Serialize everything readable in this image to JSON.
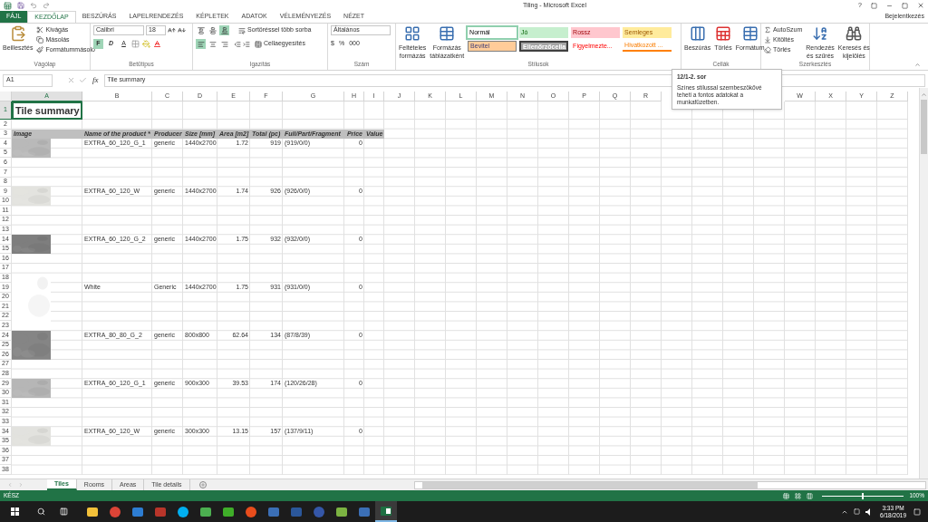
{
  "title_bar": {
    "title": "Tiling - Microsoft Excel",
    "help": "?",
    "account": "Bejelentkezés"
  },
  "tabs": [
    {
      "label": "FÁJL",
      "kind": "file",
      "selected": false
    },
    {
      "label": "KEZDŐLAP",
      "kind": "tab",
      "selected": true
    },
    {
      "label": "BESZÚRÁS",
      "kind": "tab",
      "selected": false
    },
    {
      "label": "LAPELRENDEZÉS",
      "kind": "tab",
      "selected": false
    },
    {
      "label": "KÉPLETEK",
      "kind": "tab",
      "selected": false
    },
    {
      "label": "ADATOK",
      "kind": "tab",
      "selected": false
    },
    {
      "label": "VÉLEMÉNYEZÉS",
      "kind": "tab",
      "selected": false
    },
    {
      "label": "NÉZET",
      "kind": "tab",
      "selected": false
    }
  ],
  "ribbon": {
    "clipboard": {
      "paste": "Beillesztés",
      "cut": "Kivágás",
      "copy": "Másolás",
      "format_painter": "Formátummásoló",
      "label": "Vágólap"
    },
    "font": {
      "name": "Calibri",
      "size": "18",
      "styles": [
        {
          "label": "F",
          "kind": "bold",
          "selected": true
        },
        {
          "label": "D",
          "kind": "italic",
          "selected": false
        },
        {
          "label": "A",
          "kind": "underline",
          "selected": false
        }
      ],
      "label": "Betűtípus"
    },
    "alignment": {
      "vertical": [
        {
          "kind": "top",
          "selected": false
        },
        {
          "kind": "middle",
          "selected": false
        },
        {
          "kind": "bottom",
          "selected": true
        }
      ],
      "horizontal": [
        {
          "kind": "left",
          "selected": true
        },
        {
          "kind": "center",
          "selected": false
        },
        {
          "kind": "right",
          "selected": false
        }
      ],
      "wrap": "Sortöréssel több sorba",
      "merge": "Cellaegyesítés",
      "label": "Igazítás"
    },
    "number": {
      "format": "Általános",
      "currency": "$",
      "percent": "%",
      "thousands": "000",
      "label": "Szám"
    },
    "styles": {
      "conditional": [
        "Feltételes",
        "formázás"
      ],
      "as_table": [
        "Formázás",
        "táblázatként"
      ],
      "cells": [
        {
          "label": "Normál",
          "kind": "normal",
          "selected": true
        },
        {
          "label": "Jó",
          "kind": "good",
          "selected": false
        },
        {
          "label": "Rossz",
          "kind": "bad",
          "selected": false
        },
        {
          "label": "Semleges",
          "kind": "neutral",
          "selected": false
        },
        {
          "label": "Bevitel",
          "kind": "input",
          "selected": false
        },
        {
          "label": "Ellenőrzőcella",
          "kind": "check",
          "selected": false
        },
        {
          "label": "Figyelmezte...",
          "kind": "warning",
          "selected": false
        },
        {
          "label": "Hivatkozott ...",
          "kind": "linked",
          "selected": false
        }
      ],
      "label": "Stílusok"
    },
    "cells": {
      "insert": "Beszúrás",
      "delete": "Törlés",
      "format": "Formátum",
      "label": "Cellák"
    },
    "editing": {
      "autosum": "AutoSzum",
      "fill": "Kitöltés",
      "clear": "Törlés",
      "sort": [
        "Rendezés",
        "és szűrés"
      ],
      "find": [
        "Keresés és",
        "kijelölés"
      ],
      "label": "Szerkesztés"
    }
  },
  "tooltip": {
    "title": "12/1-2. sor",
    "text": "Színes stílussal szembeszökővé teheti a fontos adatokat a munkafüzetben."
  },
  "formula_bar": {
    "name_box": "A1",
    "fx": "fx",
    "content": "Tile summary"
  },
  "sheet": {
    "title": "Tile summary",
    "columns": [
      {
        "label": "A",
        "selected": true
      },
      {
        "label": "B",
        "selected": false
      },
      {
        "label": "C",
        "selected": false
      },
      {
        "label": "D",
        "selected": false
      },
      {
        "label": "E",
        "selected": false
      },
      {
        "label": "F",
        "selected": false
      },
      {
        "label": "G",
        "selected": false
      },
      {
        "label": "H",
        "selected": false
      },
      {
        "label": "I",
        "selected": false
      },
      {
        "label": "J",
        "selected": false
      },
      {
        "label": "K",
        "selected": false
      },
      {
        "label": "L",
        "selected": false
      },
      {
        "label": "M",
        "selected": false
      },
      {
        "label": "N",
        "selected": false
      },
      {
        "label": "O",
        "selected": false
      },
      {
        "label": "P",
        "selected": false
      },
      {
        "label": "Q",
        "selected": false
      },
      {
        "label": "R",
        "selected": false
      },
      {
        "label": "W",
        "selected": false
      },
      {
        "label": "X",
        "selected": false
      },
      {
        "label": "Y",
        "selected": false
      },
      {
        "label": "Z",
        "selected": false
      }
    ],
    "rows": [
      {
        "label": "1",
        "selected": true
      },
      {
        "label": "2",
        "selected": false
      },
      {
        "label": "3",
        "selected": false
      },
      {
        "label": "4",
        "selected": false
      },
      {
        "label": "5",
        "selected": false
      },
      {
        "label": "6",
        "selected": false
      },
      {
        "label": "7",
        "selected": false
      },
      {
        "label": "8",
        "selected": false
      },
      {
        "label": "9",
        "selected": false
      },
      {
        "label": "10",
        "selected": false
      },
      {
        "label": "11",
        "selected": false
      },
      {
        "label": "12",
        "selected": false
      },
      {
        "label": "13",
        "selected": false
      },
      {
        "label": "14",
        "selected": false
      },
      {
        "label": "15",
        "selected": false
      },
      {
        "label": "16",
        "selected": false
      },
      {
        "label": "17",
        "selected": false
      },
      {
        "label": "18",
        "selected": false
      },
      {
        "label": "19",
        "selected": false
      },
      {
        "label": "20",
        "selected": false
      },
      {
        "label": "21",
        "selected": false
      },
      {
        "label": "22",
        "selected": false
      },
      {
        "label": "23",
        "selected": false
      },
      {
        "label": "24",
        "selected": false
      },
      {
        "label": "25",
        "selected": false
      },
      {
        "label": "26",
        "selected": false
      },
      {
        "label": "27",
        "selected": false
      },
      {
        "label": "28",
        "selected": false
      },
      {
        "label": "29",
        "selected": false
      },
      {
        "label": "30",
        "selected": false
      },
      {
        "label": "31",
        "selected": false
      },
      {
        "label": "32",
        "selected": false
      },
      {
        "label": "33",
        "selected": false
      },
      {
        "label": "34",
        "selected": false
      },
      {
        "label": "35",
        "selected": false
      },
      {
        "label": "36",
        "selected": false
      },
      {
        "label": "37",
        "selected": false
      },
      {
        "label": "38",
        "selected": false
      }
    ],
    "headers": [
      "Image",
      "Name of the product *",
      "Producer",
      "Size [mm]",
      "Area [m2]",
      "Total (pc)",
      "Full/Part/Fragment",
      "Price",
      "Value"
    ],
    "products": [
      {
        "name": "EXTRA_60_120_G_1",
        "producer": "generic",
        "size": "1440x2700",
        "area": "1.72",
        "total": "919",
        "parts": "(919/0/0)",
        "price": "0"
      },
      {
        "name": "EXTRA_60_120_W",
        "producer": "generic",
        "size": "1440x2700",
        "area": "1.74",
        "total": "926",
        "parts": "(926/0/0)",
        "price": "0"
      },
      {
        "name": "EXTRA_60_120_G_2",
        "producer": "generic",
        "size": "1440x2700",
        "area": "1.75",
        "total": "932",
        "parts": "(932/0/0)",
        "price": "0"
      },
      {
        "name": "White",
        "producer": "Generic",
        "size": "1440x2700",
        "area": "1.75",
        "total": "931",
        "parts": "(931/0/0)",
        "price": "0"
      },
      {
        "name": "EXTRA_80_80_G_2",
        "producer": "generic",
        "size": "800x800",
        "area": "62.64",
        "total": "134",
        "parts": "(87/8/39)",
        "price": "0"
      },
      {
        "name": "EXTRA_60_120_G_1",
        "producer": "generic",
        "size": "900x300",
        "area": "39.53",
        "total": "174",
        "parts": "(120/26/28)",
        "price": "0"
      },
      {
        "name": "EXTRA_60_120_W",
        "producer": "generic",
        "size": "300x300",
        "area": "13.15",
        "total": "157",
        "parts": "(137/9/11)",
        "price": "0"
      }
    ]
  },
  "sheet_tabs": [
    {
      "label": "Tiles",
      "selected": true
    },
    {
      "label": "Rooms",
      "selected": false
    },
    {
      "label": "Areas",
      "selected": false
    },
    {
      "label": "Tile details",
      "selected": false
    }
  ],
  "status_bar": {
    "status": "KÉSZ",
    "zoom_slider": {
      "level": 0.5
    },
    "zoom": "100%"
  },
  "taskbar": {
    "time": "3:33 PM",
    "date": "6/18/2019"
  }
}
